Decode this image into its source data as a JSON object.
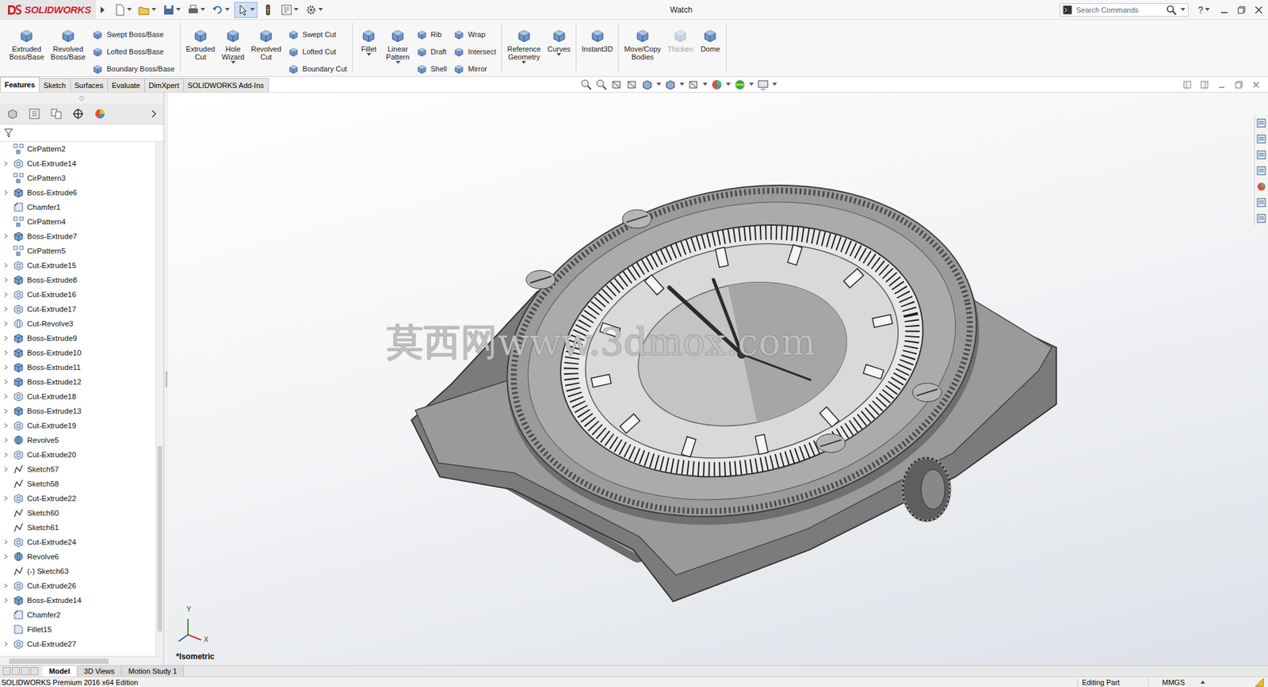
{
  "app": {
    "logo": "SOLIDWORKS",
    "title": "Watch",
    "search_placeholder": "Search Commands",
    "help": "?"
  },
  "ribbon": [
    [
      {
        "kind": "large",
        "label": [
          "Extruded",
          "Boss/Base"
        ],
        "dropdown": false,
        "disabled": false
      },
      {
        "kind": "large",
        "label": [
          "Revolved",
          "Boss/Base"
        ],
        "dropdown": false,
        "disabled": false
      },
      {
        "kind": "stack",
        "items": [
          "Swept Boss/Base",
          "Lofted Boss/Base",
          "Boundary Boss/Base"
        ]
      }
    ],
    [
      {
        "kind": "large",
        "label": [
          "Extruded",
          "Cut"
        ],
        "dropdown": false,
        "disabled": false
      },
      {
        "kind": "large",
        "label": [
          "Hole",
          "Wizard"
        ],
        "dropdown": true,
        "disabled": false
      },
      {
        "kind": "large",
        "label": [
          "Revolved",
          "Cut"
        ],
        "dropdown": false,
        "disabled": false
      },
      {
        "kind": "stack",
        "items": [
          "Swept Cut",
          "Lofted Cut",
          "Boundary Cut"
        ]
      }
    ],
    [
      {
        "kind": "large",
        "label": [
          "Fillet"
        ],
        "dropdown": true,
        "disabled": false
      },
      {
        "kind": "large",
        "label": [
          "Linear",
          "Pattern"
        ],
        "dropdown": true,
        "disabled": false
      },
      {
        "kind": "stack",
        "items": [
          "Rib",
          "Draft",
          "Shell"
        ]
      },
      {
        "kind": "stack",
        "items": [
          "Wrap",
          "Intersect",
          "Mirror"
        ]
      }
    ],
    [
      {
        "kind": "large",
        "label": [
          "Reference",
          "Geometry"
        ],
        "dropdown": true,
        "disabled": false
      },
      {
        "kind": "large",
        "label": [
          "Curves"
        ],
        "dropdown": true,
        "disabled": false
      }
    ],
    [
      {
        "kind": "large",
        "label": [
          "Instant3D"
        ],
        "dropdown": false,
        "disabled": false
      }
    ],
    [
      {
        "kind": "large",
        "label": [
          "Move/Copy",
          "Bodies"
        ],
        "dropdown": false,
        "disabled": false
      },
      {
        "kind": "large",
        "label": [
          "Thicken"
        ],
        "dropdown": false,
        "disabled": true
      },
      {
        "kind": "large",
        "label": [
          "Dome"
        ],
        "dropdown": false,
        "disabled": false
      }
    ]
  ],
  "tabs": [
    {
      "label": "Features",
      "selected": true
    },
    {
      "label": "Sketch",
      "selected": false
    },
    {
      "label": "Surfaces",
      "selected": false
    },
    {
      "label": "Evaluate",
      "selected": false
    },
    {
      "label": "DimXpert",
      "selected": false
    },
    {
      "label": "SOLIDWORKS Add-Ins",
      "selected": false
    }
  ],
  "tree": [
    {
      "label": "CirPattern2",
      "kind": "pattern",
      "expandable": false
    },
    {
      "label": "Cut-Extrude14",
      "kind": "cut",
      "expandable": true
    },
    {
      "label": "CirPattern3",
      "kind": "pattern",
      "expandable": false
    },
    {
      "label": "Boss-Extrude6",
      "kind": "boss",
      "expandable": true
    },
    {
      "label": "Chamfer1",
      "kind": "chamfer",
      "expandable": false
    },
    {
      "label": "CirPattern4",
      "kind": "pattern",
      "expandable": false
    },
    {
      "label": "Boss-Extrude7",
      "kind": "boss",
      "expandable": true
    },
    {
      "label": "CirPattern5",
      "kind": "pattern",
      "expandable": false
    },
    {
      "label": "Cut-Extrude15",
      "kind": "cut",
      "expandable": true
    },
    {
      "label": "Boss-Extrude8",
      "kind": "boss",
      "expandable": true
    },
    {
      "label": "Cut-Extrude16",
      "kind": "cut",
      "expandable": true
    },
    {
      "label": "Cut-Extrude17",
      "kind": "cut",
      "expandable": true
    },
    {
      "label": "Cut-Revolve3",
      "kind": "cutrevolve",
      "expandable": true
    },
    {
      "label": "Boss-Extrude9",
      "kind": "boss",
      "expandable": true
    },
    {
      "label": "Boss-Extrude10",
      "kind": "boss",
      "expandable": true
    },
    {
      "label": "Boss-Extrude11",
      "kind": "boss",
      "expandable": true
    },
    {
      "label": "Boss-Extrude12",
      "kind": "boss",
      "expandable": true
    },
    {
      "label": "Cut-Extrude18",
      "kind": "cut",
      "expandable": true
    },
    {
      "label": "Boss-Extrude13",
      "kind": "boss",
      "expandable": true
    },
    {
      "label": "Cut-Extrude19",
      "kind": "cut",
      "expandable": true
    },
    {
      "label": "Revolve5",
      "kind": "revolve",
      "expandable": true
    },
    {
      "label": "Cut-Extrude20",
      "kind": "cut",
      "expandable": true
    },
    {
      "label": "Sketch57",
      "kind": "sketch",
      "expandable": true
    },
    {
      "label": "Sketch58",
      "kind": "sketch",
      "expandable": false
    },
    {
      "label": "Cut-Extrude22",
      "kind": "cut",
      "expandable": true
    },
    {
      "label": "Sketch60",
      "kind": "sketch",
      "expandable": false
    },
    {
      "label": "Sketch61",
      "kind": "sketch",
      "expandable": false
    },
    {
      "label": "Cut-Extrude24",
      "kind": "cut",
      "expandable": true
    },
    {
      "label": "Revolve6",
      "kind": "revolve",
      "expandable": true
    },
    {
      "label": "(-) Sketch63",
      "kind": "sketch",
      "expandable": false
    },
    {
      "label": "Cut-Extrude26",
      "kind": "cut",
      "expandable": true
    },
    {
      "label": "Boss-Extrude14",
      "kind": "boss",
      "expandable": true
    },
    {
      "label": "Chamfer2",
      "kind": "chamfer",
      "expandable": false
    },
    {
      "label": "Fillet15",
      "kind": "fillet",
      "expandable": false
    },
    {
      "label": "Cut-Extrude27",
      "kind": "cut",
      "expandable": true
    }
  ],
  "viewport": {
    "view": "*Isometric",
    "watermark": "莫西网www.3dmox.com",
    "triad_labels": [
      "Y",
      "X"
    ]
  },
  "bottom_tabs": [
    {
      "label": "Model",
      "selected": true
    },
    {
      "label": "3D Views",
      "selected": false
    },
    {
      "label": "Motion Study 1",
      "selected": false
    }
  ],
  "status_bar": {
    "edition": "SOLIDWORKS Premium 2016 x64 Edition",
    "mode": "Editing Part",
    "units": "MMGS"
  }
}
